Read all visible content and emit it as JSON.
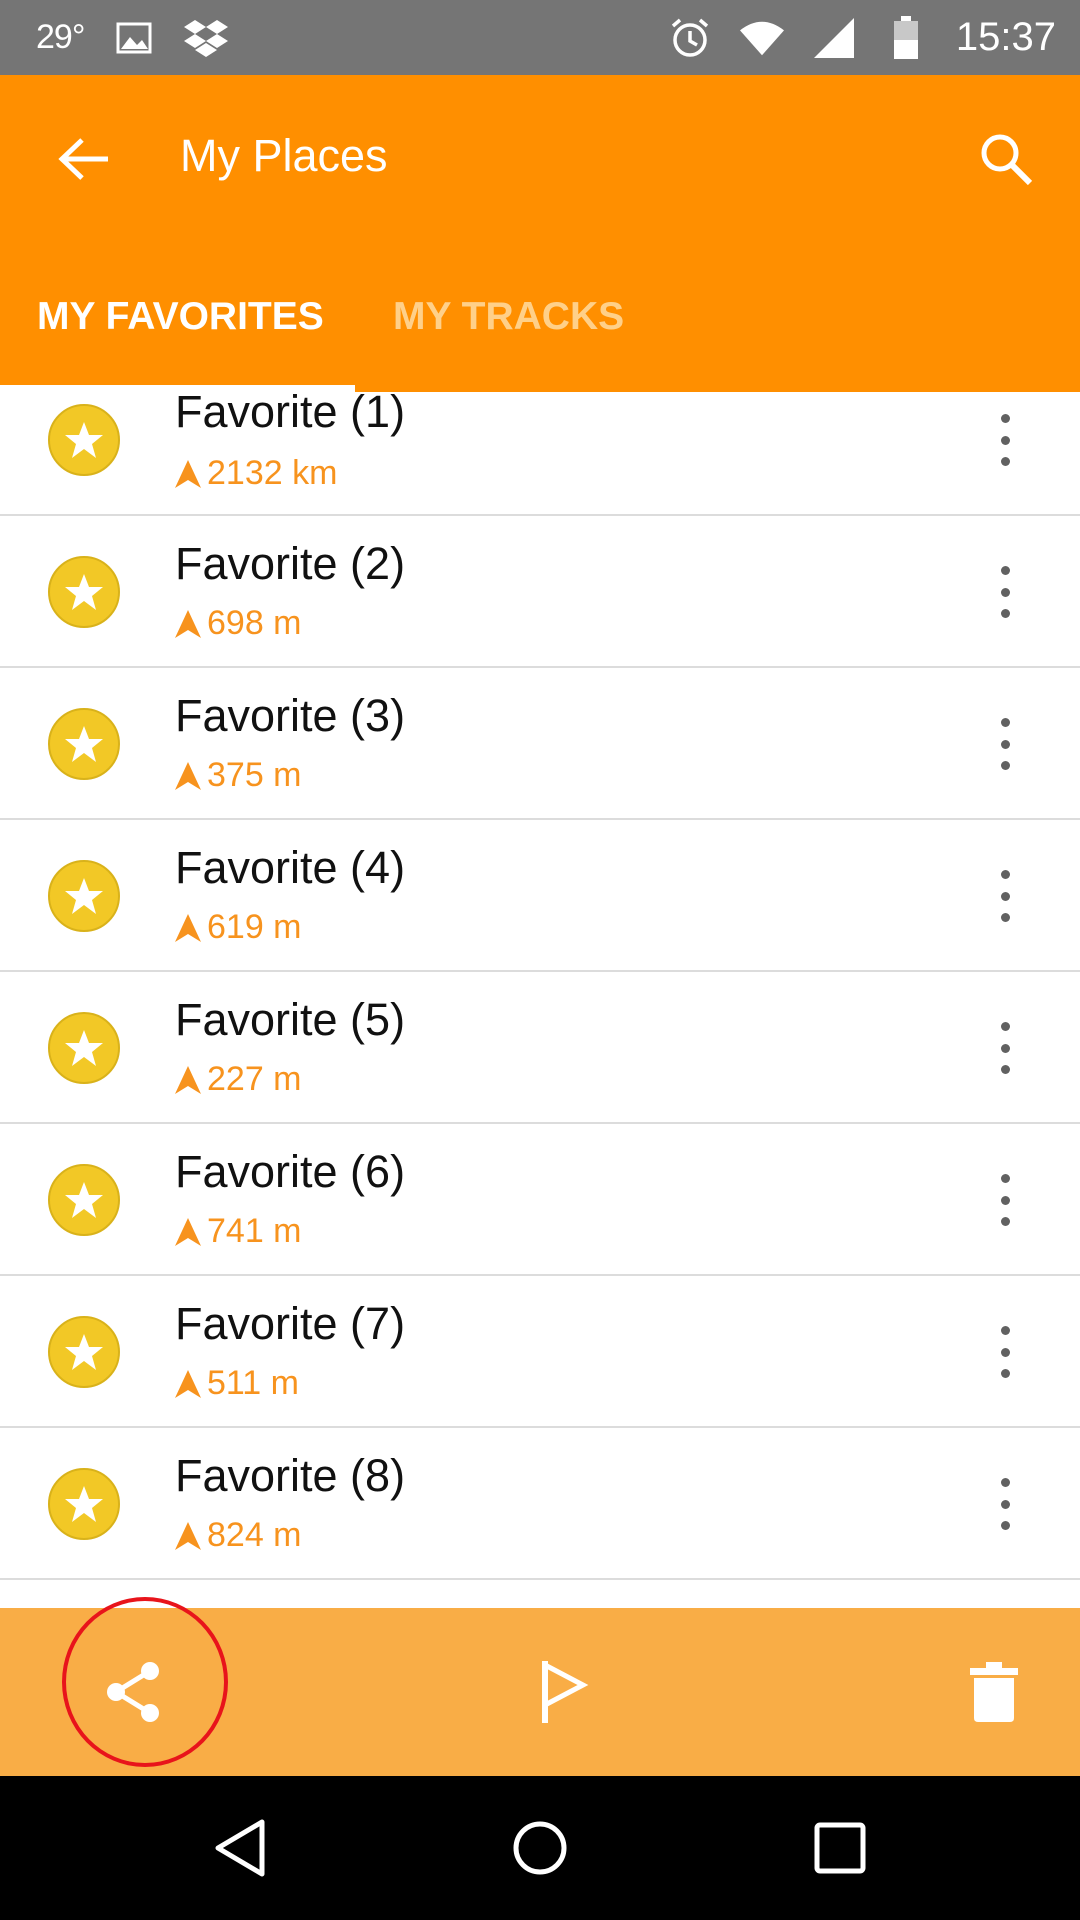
{
  "status_bar": {
    "temperature": "29°",
    "time": "15:37",
    "icons": [
      "image-icon",
      "dropbox-icon",
      "alarm-icon",
      "wifi-icon",
      "signal-icon",
      "battery-icon"
    ]
  },
  "app_bar": {
    "title": "My Places",
    "back_icon": "arrow-back-icon",
    "search_icon": "search-icon",
    "color": "#ff8f00"
  },
  "tabs": [
    {
      "label": "MY FAVORITES",
      "selected": true
    },
    {
      "label": "MY TRACKS",
      "selected": false
    }
  ],
  "favorites": [
    {
      "title": "Favorite (1)",
      "distance": "2132 km"
    },
    {
      "title": "Favorite (2)",
      "distance": "698 m"
    },
    {
      "title": "Favorite (3)",
      "distance": "375 m"
    },
    {
      "title": "Favorite (4)",
      "distance": "619 m"
    },
    {
      "title": "Favorite (5)",
      "distance": "227 m"
    },
    {
      "title": "Favorite (6)",
      "distance": "741 m"
    },
    {
      "title": "Favorite (7)",
      "distance": "511 m"
    },
    {
      "title": "Favorite (8)",
      "distance": "824 m"
    }
  ],
  "action_bar": {
    "color": "#f9ad46",
    "actions": [
      "share-icon",
      "flag-icon",
      "delete-icon"
    ]
  },
  "nav_bar": {
    "buttons": [
      "nav-back-icon",
      "nav-home-icon",
      "nav-recents-icon"
    ]
  },
  "colors": {
    "accent": "#ff8f00",
    "distance_text": "#f7931e",
    "favorite_icon": "#f2c826",
    "highlight": "#e8141b"
  }
}
